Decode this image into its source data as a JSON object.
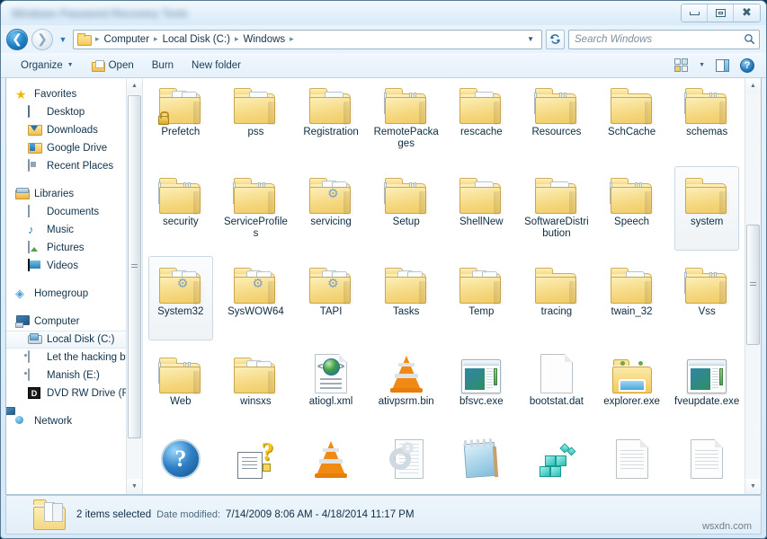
{
  "window": {
    "title_obscured": "Windows Password Recovery Tools",
    "controls": {
      "minimize": "Minimize",
      "maximize": "Maximize",
      "close": "Close"
    }
  },
  "address_bar": {
    "back": "Back",
    "forward": "Forward",
    "history": "Recent pages",
    "crumbs": [
      "Computer",
      "Local Disk (C:)",
      "Windows"
    ],
    "separator": "▸",
    "dropdown": "▼",
    "refresh": "↻"
  },
  "search": {
    "placeholder": "Search Windows",
    "value": ""
  },
  "toolbar": {
    "organize": "Organize",
    "open": "Open",
    "burn": "Burn",
    "new_folder": "New folder",
    "caret": "▼",
    "views": "Change your view",
    "preview_pane": "Show the preview pane",
    "help": "?"
  },
  "sidebar": {
    "groups": [
      {
        "header": {
          "label": "Favorites",
          "icon": "star-icon"
        },
        "items": [
          {
            "label": "Desktop",
            "icon": "desktop-icon"
          },
          {
            "label": "Downloads",
            "icon": "downloads-folder-icon"
          },
          {
            "label": "Google Drive",
            "icon": "google-drive-folder-icon"
          },
          {
            "label": "Recent Places",
            "icon": "recent-places-icon"
          }
        ]
      },
      {
        "header": {
          "label": "Libraries",
          "icon": "libraries-icon"
        },
        "items": [
          {
            "label": "Documents",
            "icon": "document-icon"
          },
          {
            "label": "Music",
            "icon": "music-note-icon"
          },
          {
            "label": "Pictures",
            "icon": "picture-icon"
          },
          {
            "label": "Videos",
            "icon": "video-icon"
          }
        ]
      },
      {
        "header": {
          "label": "Homegroup",
          "icon": "homegroup-icon"
        },
        "items": []
      },
      {
        "header": {
          "label": "Computer",
          "icon": "computer-icon"
        },
        "items": [
          {
            "label": "Local Disk (C:)",
            "icon": "hard-disk-icon",
            "selected": true
          },
          {
            "label": "Let the hacking b",
            "icon": "drive-icon"
          },
          {
            "label": "Manish (E:)",
            "icon": "drive-icon"
          },
          {
            "label": "DVD RW Drive (F:",
            "icon": "dvd-drive-icon"
          }
        ]
      },
      {
        "header": {
          "label": "Network",
          "icon": "network-icon"
        },
        "items": []
      }
    ]
  },
  "files": [
    {
      "name": "Prefetch",
      "type": "folder-papers-lock"
    },
    {
      "name": "pss",
      "type": "folder-paper"
    },
    {
      "name": "Registration",
      "type": "folder-paper"
    },
    {
      "name": "RemotePackages",
      "type": "folder-files"
    },
    {
      "name": "rescache",
      "type": "folder-paper"
    },
    {
      "name": "Resources",
      "type": "folder-files"
    },
    {
      "name": "SchCache",
      "type": "folder-plain"
    },
    {
      "name": "schemas",
      "type": "folder-files"
    },
    {
      "name": "security",
      "type": "folder-files"
    },
    {
      "name": "ServiceProfiles",
      "type": "folder-files"
    },
    {
      "name": "servicing",
      "type": "folder-gear"
    },
    {
      "name": "Setup",
      "type": "folder-files"
    },
    {
      "name": "ShellNew",
      "type": "folder-paper"
    },
    {
      "name": "SoftwareDistribution",
      "type": "folder-paper"
    },
    {
      "name": "Speech",
      "type": "folder-files"
    },
    {
      "name": "system",
      "type": "folder-plain",
      "selected": true
    },
    {
      "name": "System32",
      "type": "folder-gear",
      "selected": true
    },
    {
      "name": "SysWOW64",
      "type": "folder-gear"
    },
    {
      "name": "TAPI",
      "type": "folder-gear"
    },
    {
      "name": "Tasks",
      "type": "folder-papers"
    },
    {
      "name": "Temp",
      "type": "folder-papers"
    },
    {
      "name": "tracing",
      "type": "folder-plain"
    },
    {
      "name": "twain_32",
      "type": "folder-paper"
    },
    {
      "name": "Vss",
      "type": "folder-files"
    },
    {
      "name": "Web",
      "type": "folder-files"
    },
    {
      "name": "winsxs",
      "type": "folder-papers"
    },
    {
      "name": "atiogl.xml",
      "type": "xml-file"
    },
    {
      "name": "ativpsrm.bin",
      "type": "vlc-file"
    },
    {
      "name": "bfsvc.exe",
      "type": "exe-file"
    },
    {
      "name": "bootstat.dat",
      "type": "blank-file"
    },
    {
      "name": "explorer.exe",
      "type": "explorer-exe"
    },
    {
      "name": "fveupdate.exe",
      "type": "exe-file"
    },
    {
      "name": "",
      "type": "help-blue"
    },
    {
      "name": "",
      "type": "help-chm"
    },
    {
      "name": "",
      "type": "vlc-file"
    },
    {
      "name": "",
      "type": "gear-doc"
    },
    {
      "name": "",
      "type": "notepad-file"
    },
    {
      "name": "",
      "type": "cube-file"
    },
    {
      "name": "",
      "type": "lined-file"
    },
    {
      "name": "",
      "type": "lined-file"
    }
  ],
  "status": {
    "selection": "2 items selected",
    "date_label": "Date modified:",
    "date_value": "7/14/2009 8:06 AM - 4/18/2014 11:17 PM"
  },
  "watermark": "wsxdn.com",
  "scrollbars": {
    "up_arrow": "▲",
    "down_arrow": "▼"
  },
  "colors": {
    "accent": "#2a7fc0",
    "folder": "#f5d784",
    "chrome": "#dfeefa",
    "selection": "#eff3f6"
  }
}
